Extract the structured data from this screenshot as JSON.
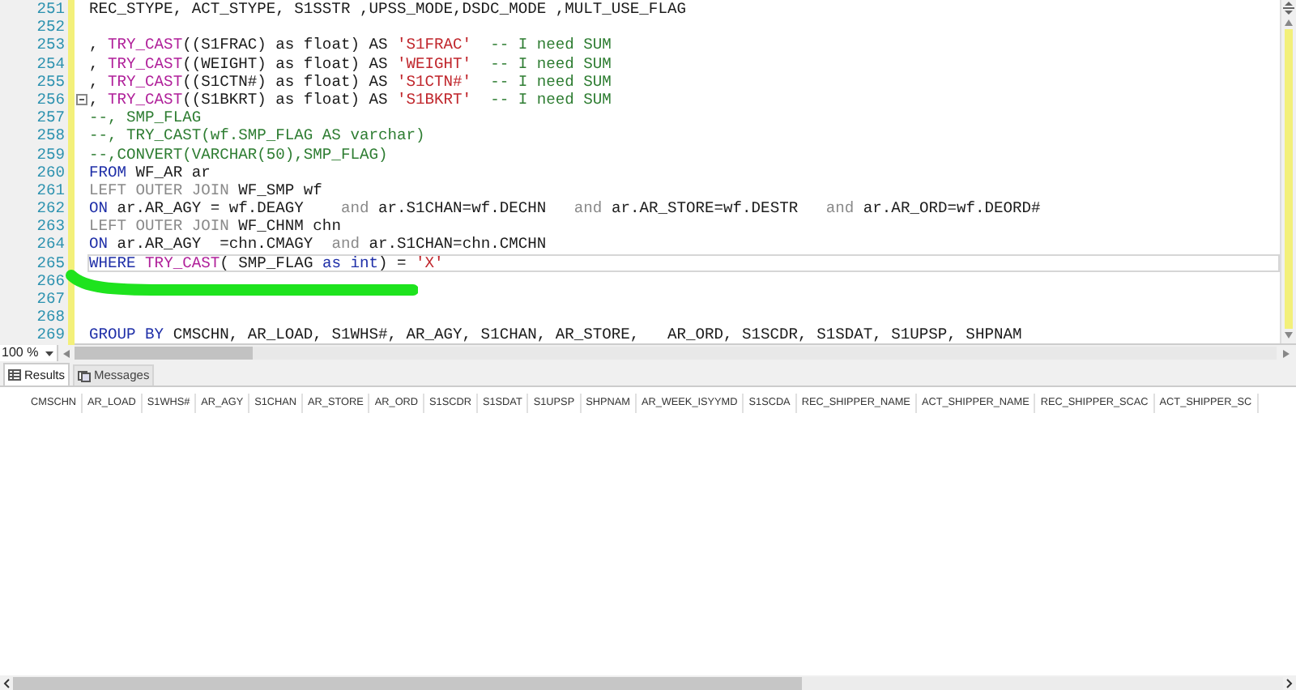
{
  "editor": {
    "lines": [
      {
        "number": "251",
        "current": false,
        "fold": false,
        "tokens": [
          {
            "kind": "text",
            "text": "REC_STYPE, ACT_STYPE, S1SSTR ,UPSS_MODE,DSDC_MODE ,MULT_USE_FLAG"
          }
        ]
      },
      {
        "number": "252",
        "current": false,
        "fold": false
      },
      {
        "number": "253",
        "current": false,
        "fold": false,
        "tokens": [
          {
            "kind": "text",
            "text": ", "
          },
          {
            "kind": "function",
            "text": "TRY_CAST"
          },
          {
            "kind": "text",
            "text": "((S1FRAC) as float) AS "
          },
          {
            "kind": "string",
            "text": "'S1FRAC'"
          },
          {
            "kind": "comment",
            "text": "  -- I need SUM"
          }
        ]
      },
      {
        "number": "254",
        "current": false,
        "fold": false,
        "tokens": [
          {
            "kind": "text",
            "text": ", "
          },
          {
            "kind": "function",
            "text": "TRY_CAST"
          },
          {
            "kind": "text",
            "text": "((WEIGHT) as float) AS "
          },
          {
            "kind": "string",
            "text": "'WEIGHT'"
          },
          {
            "kind": "comment",
            "text": "  -- I need SUM"
          }
        ]
      },
      {
        "number": "255",
        "current": false,
        "fold": false,
        "tokens": [
          {
            "kind": "text",
            "text": ", "
          },
          {
            "kind": "function",
            "text": "TRY_CAST"
          },
          {
            "kind": "text",
            "text": "((S1CTN#) as float) AS "
          },
          {
            "kind": "string",
            "text": "'S1CTN#'"
          },
          {
            "kind": "comment",
            "text": "  -- I need SUM"
          }
        ]
      },
      {
        "number": "256",
        "current": false,
        "fold": true,
        "tokens": [
          {
            "kind": "text",
            "text": ", "
          },
          {
            "kind": "function",
            "text": "TRY_CAST"
          },
          {
            "kind": "text",
            "text": "((S1BKRT) as float) AS "
          },
          {
            "kind": "string",
            "text": "'S1BKRT'"
          },
          {
            "kind": "comment",
            "text": "  -- I need SUM"
          }
        ]
      },
      {
        "number": "257",
        "current": false,
        "fold": false,
        "tokens": [
          {
            "kind": "comment",
            "text": "--, SMP_FLAG"
          }
        ]
      },
      {
        "number": "258",
        "current": false,
        "fold": false,
        "tokens": [
          {
            "kind": "comment",
            "text": "--, TRY_CAST(wf.SMP_FLAG AS varchar)"
          }
        ]
      },
      {
        "number": "259",
        "current": false,
        "fold": false,
        "tokens": [
          {
            "kind": "comment",
            "text": "--,CONVERT(VARCHAR(50),SMP_FLAG)"
          }
        ]
      },
      {
        "number": "260",
        "current": false,
        "fold": false,
        "tokens": [
          {
            "kind": "keyword",
            "text": "FROM"
          },
          {
            "kind": "text",
            "text": " WF_AR ar"
          }
        ]
      },
      {
        "number": "261",
        "current": false,
        "fold": false,
        "tokens": [
          {
            "kind": "dim",
            "text": "LEFT OUTER JOIN"
          },
          {
            "kind": "text",
            "text": " WF_SMP wf"
          }
        ]
      },
      {
        "number": "262",
        "current": false,
        "fold": false,
        "tokens": [
          {
            "kind": "keyword",
            "text": "ON"
          },
          {
            "kind": "text",
            "text": " ar.AR_AGY = wf.DEAGY    "
          },
          {
            "kind": "dim",
            "text": "and"
          },
          {
            "kind": "text",
            "text": " ar.S1CHAN=wf.DECHN   "
          },
          {
            "kind": "dim",
            "text": "and"
          },
          {
            "kind": "text",
            "text": " ar.AR_STORE=wf.DESTR   "
          },
          {
            "kind": "dim",
            "text": "and"
          },
          {
            "kind": "text",
            "text": " ar.AR_ORD=wf.DEORD#"
          }
        ]
      },
      {
        "number": "263",
        "current": false,
        "fold": false,
        "tokens": [
          {
            "kind": "dim",
            "text": "LEFT OUTER JOIN"
          },
          {
            "kind": "text",
            "text": " WF_CHNM chn"
          }
        ]
      },
      {
        "number": "264",
        "current": false,
        "fold": false,
        "tokens": [
          {
            "kind": "keyword",
            "text": "ON"
          },
          {
            "kind": "text",
            "text": " ar.AR_AGY  =chn.CMAGY  "
          },
          {
            "kind": "dim",
            "text": "and"
          },
          {
            "kind": "text",
            "text": " ar.S1CHAN=chn.CMCHN"
          }
        ]
      },
      {
        "number": "265",
        "current": true,
        "fold": false,
        "tokens": [
          {
            "kind": "keyword",
            "text": "WHERE"
          },
          {
            "kind": "function",
            "text": " TRY_CAST"
          },
          {
            "kind": "text",
            "text": "( SMP_FLAG "
          },
          {
            "kind": "keyword",
            "text": "as"
          },
          {
            "kind": "keyword",
            "text": " int"
          },
          {
            "kind": "text",
            "text": ") = "
          },
          {
            "kind": "string",
            "text": "'X'"
          }
        ]
      },
      {
        "number": "266",
        "current": false,
        "fold": false
      },
      {
        "number": "267",
        "current": false,
        "fold": false
      },
      {
        "number": "268",
        "current": false,
        "fold": false
      },
      {
        "number": "269",
        "current": false,
        "fold": false,
        "tokens": [
          {
            "kind": "keyword",
            "text": "GROUP BY"
          },
          {
            "kind": "text",
            "text": " CMSCHN, AR_LOAD, S1WHS#, AR_AGY, S1CHAN, AR_STORE,   AR_ORD, S1SCDR, S1SDAT, S1UPSP, SHPNAM"
          }
        ]
      }
    ]
  },
  "zoom": "100 %",
  "tabs": [
    {
      "label": "Results",
      "selected": true
    },
    {
      "label": "Messages",
      "selected": false
    }
  ],
  "grid": {
    "columns": [
      "CMSCHN",
      "AR_LOAD",
      "S1WHS#",
      "AR_AGY",
      "S1CHAN",
      "AR_STORE",
      "AR_ORD",
      "S1SCDR",
      "S1SDAT",
      "S1UPSP",
      "SHPNAM",
      "AR_WEEK_ISYYMD",
      "S1SCDA",
      "REC_SHIPPER_NAME",
      "ACT_SHIPPER_NAME",
      "REC_SHIPPER_SCAC",
      "ACT_SHIPPER_SC"
    ]
  }
}
